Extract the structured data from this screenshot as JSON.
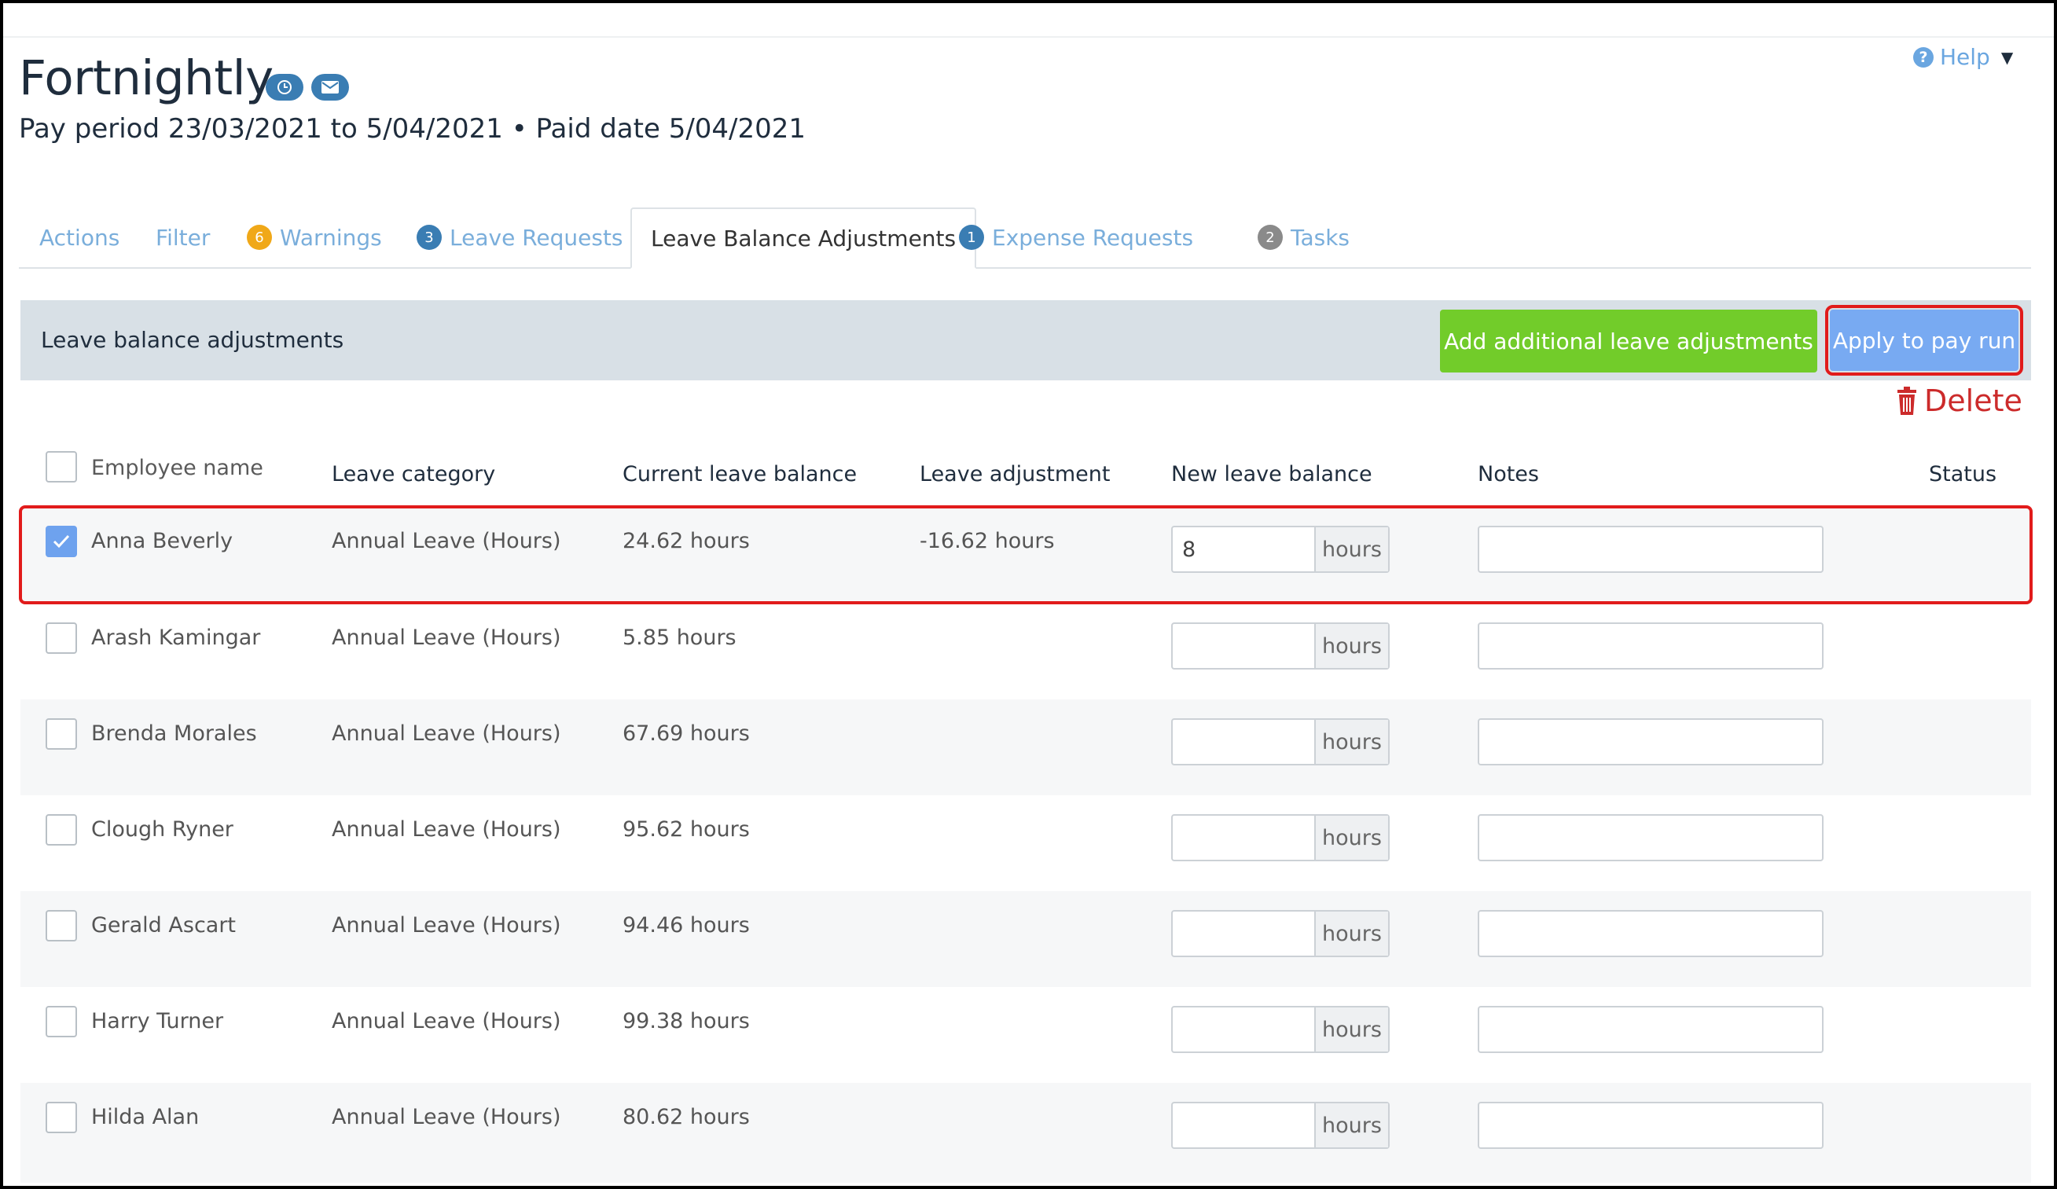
{
  "header": {
    "title": "Fortnightly",
    "icons": [
      "clock-icon",
      "email-icon"
    ],
    "subtitle": "Pay period 23/03/2021 to 5/04/2021 • Paid date 5/04/2021",
    "help_label": "Help"
  },
  "tabs": [
    {
      "label": "Actions"
    },
    {
      "label": "Filter"
    },
    {
      "label": "Warnings",
      "badge": "6",
      "badge_color": "#f0a818"
    },
    {
      "label": "Leave Requests",
      "badge": "3",
      "badge_color": "#3a7db3"
    },
    {
      "label": "Leave Balance Adjustments",
      "active": true
    },
    {
      "label": "Expense Requests",
      "badge": "1",
      "badge_color": "#3a7db3"
    },
    {
      "label": "Tasks",
      "badge": "2",
      "badge_color": "#8a8a8a"
    }
  ],
  "panel": {
    "title": "Leave balance adjustments",
    "add_button": "Add additional leave adjustments",
    "apply_button": "Apply to pay run",
    "delete_label": "Delete"
  },
  "table": {
    "columns": {
      "employee": "Employee name",
      "category": "Leave category",
      "current": "Current leave balance",
      "adjustment": "Leave adjustment",
      "new_balance": "New leave balance",
      "notes": "Notes",
      "status": "Status"
    },
    "unit": "hours",
    "rows": [
      {
        "name": "Anna Beverly",
        "category": "Annual Leave (Hours)",
        "current": "24.62 hours",
        "adjustment": "-16.62 hours",
        "new_balance": "8",
        "notes": "",
        "checked": true
      },
      {
        "name": "Arash Kamingar",
        "category": "Annual Leave (Hours)",
        "current": "5.85 hours",
        "adjustment": "",
        "new_balance": "",
        "notes": "",
        "checked": false
      },
      {
        "name": "Brenda Morales",
        "category": "Annual Leave (Hours)",
        "current": "67.69 hours",
        "adjustment": "",
        "new_balance": "",
        "notes": "",
        "checked": false
      },
      {
        "name": "Clough Ryner",
        "category": "Annual Leave (Hours)",
        "current": "95.62 hours",
        "adjustment": "",
        "new_balance": "",
        "notes": "",
        "checked": false
      },
      {
        "name": "Gerald Ascart",
        "category": "Annual Leave (Hours)",
        "current": "94.46 hours",
        "adjustment": "",
        "new_balance": "",
        "notes": "",
        "checked": false
      },
      {
        "name": "Harry Turner",
        "category": "Annual Leave (Hours)",
        "current": "99.38 hours",
        "adjustment": "",
        "new_balance": "",
        "notes": "",
        "checked": false
      },
      {
        "name": "Hilda Alan",
        "category": "Annual Leave (Hours)",
        "current": "80.62 hours",
        "adjustment": "",
        "new_balance": "",
        "notes": "",
        "checked": false
      }
    ]
  },
  "colors": {
    "primary_text": "#1f2d3d",
    "link": "#7aaedb",
    "green_button": "#72cc2a",
    "blue_button": "#78aaf2",
    "highlight_border": "#e11b1b",
    "delete": "#cc2b2b"
  }
}
